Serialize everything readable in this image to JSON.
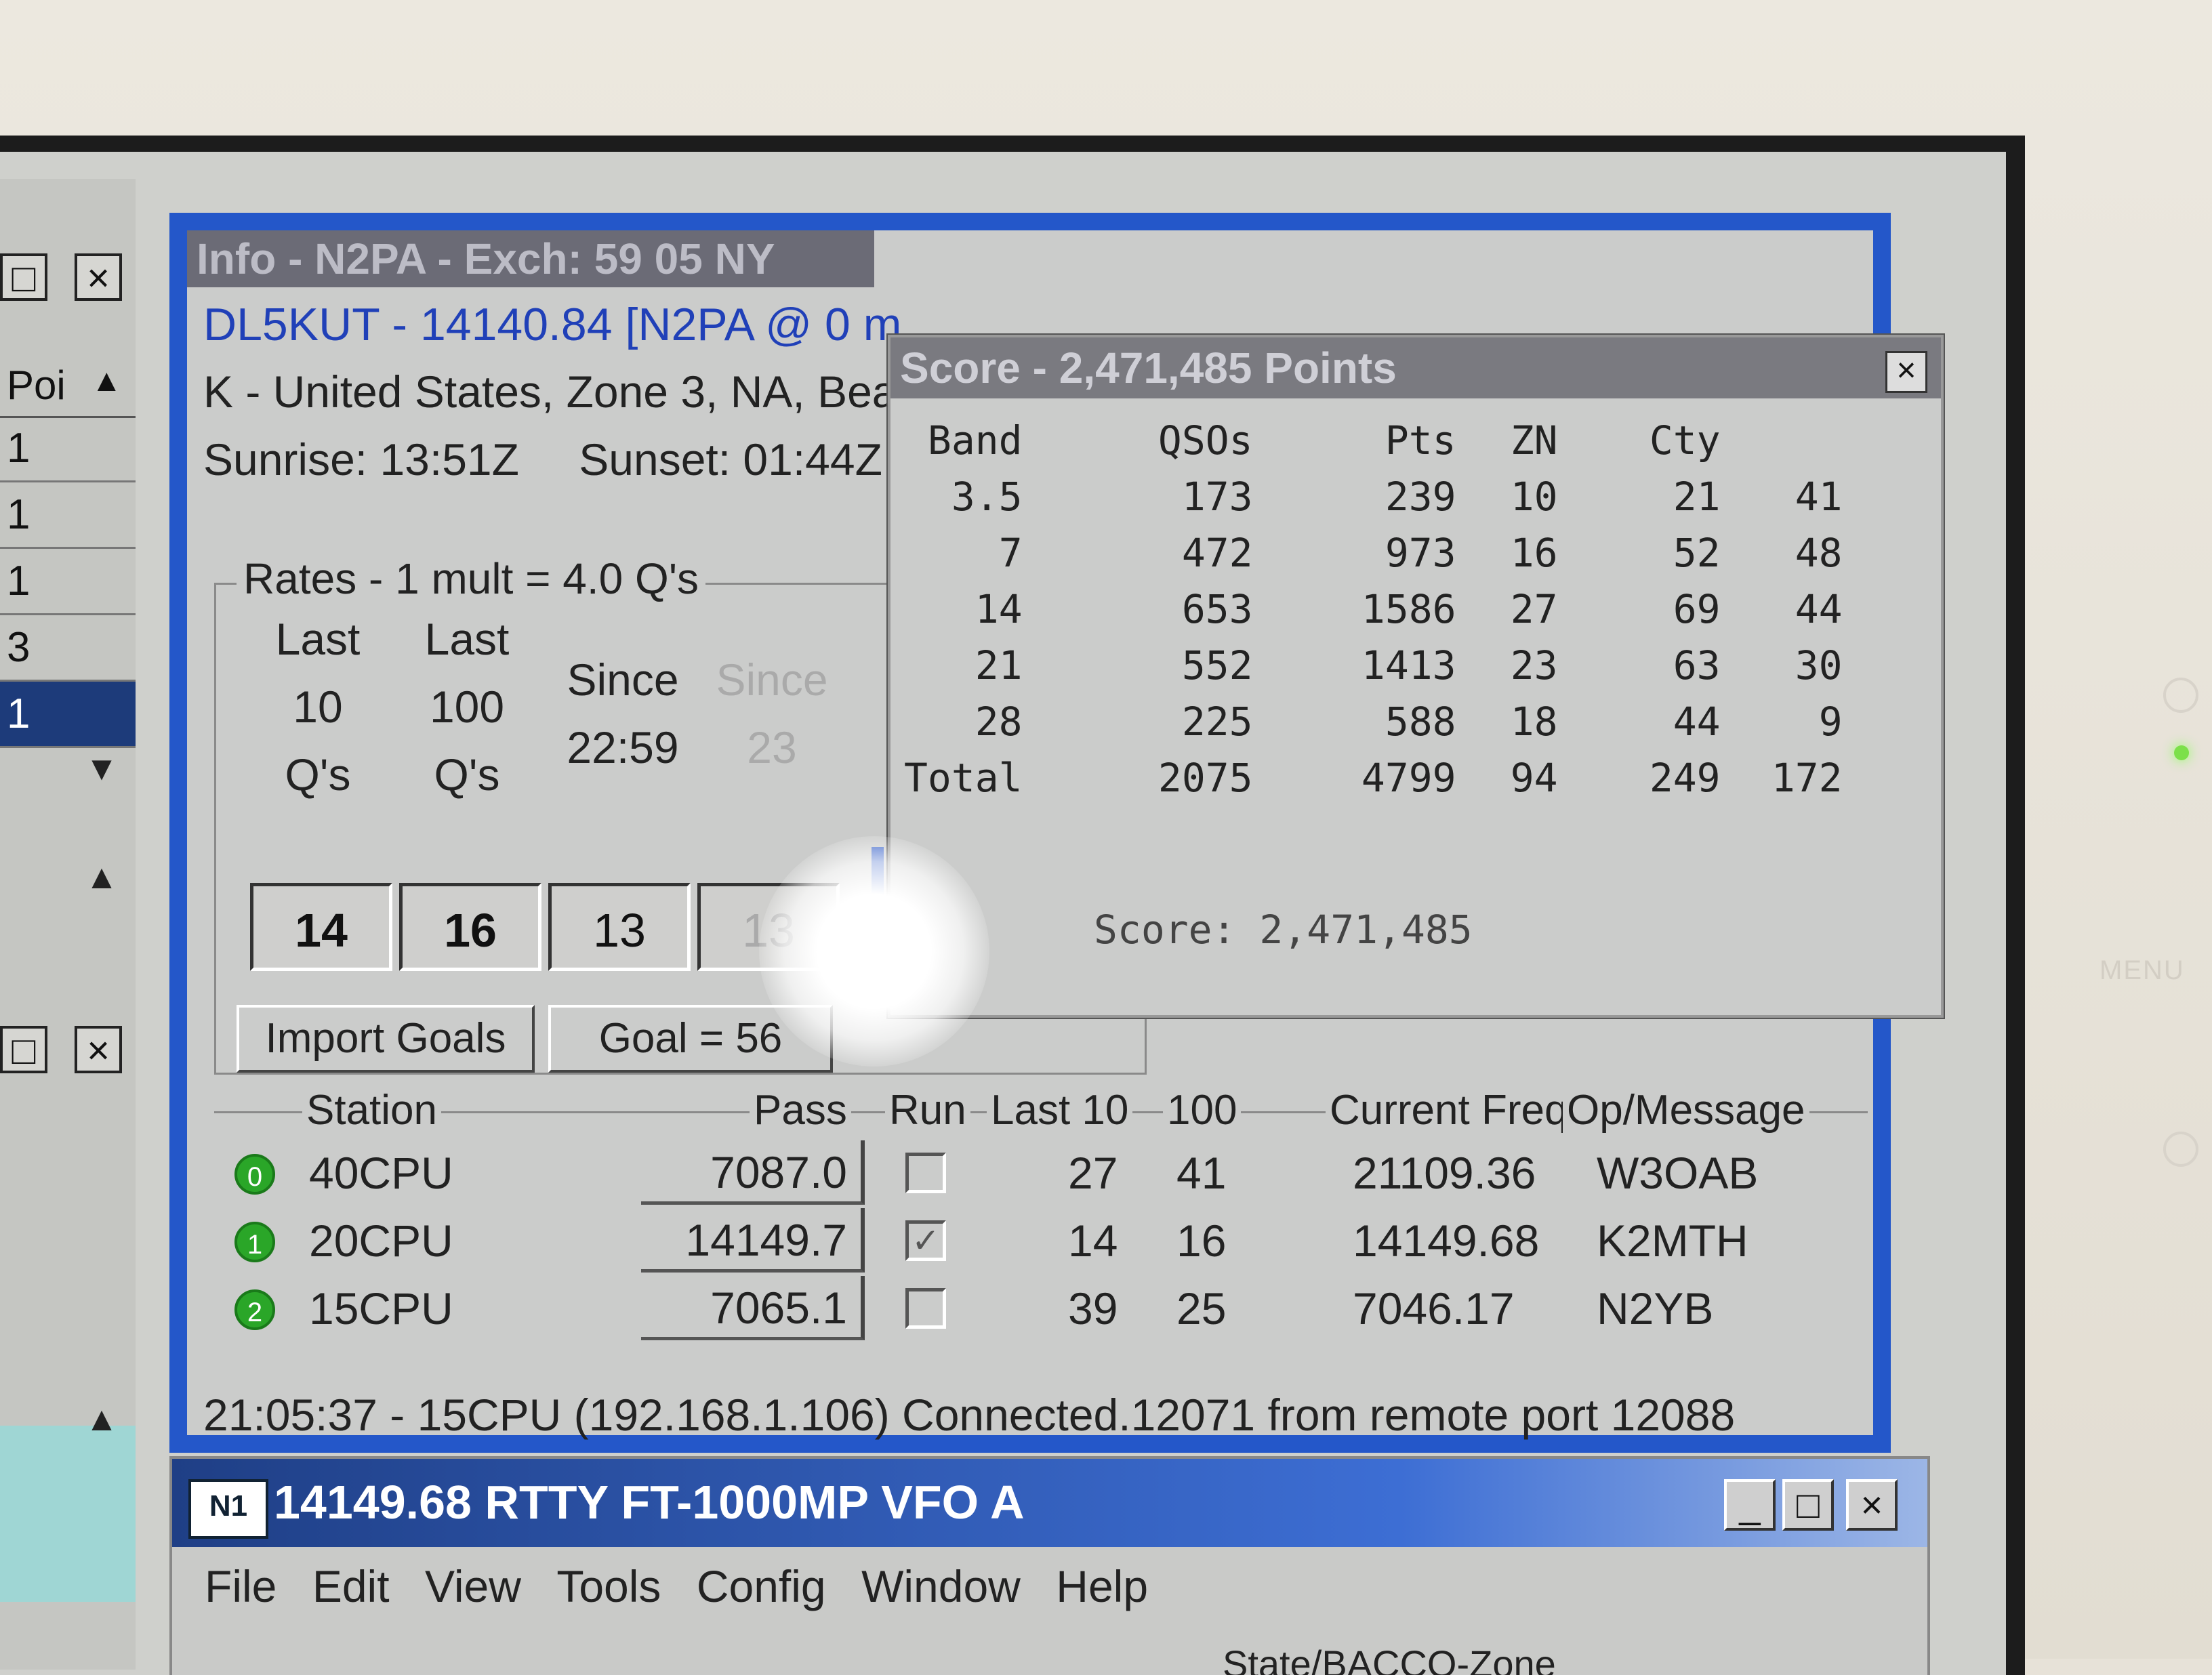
{
  "left_window": {
    "poi_header": "Poi",
    "rows": [
      "1",
      "1",
      "1",
      "3",
      "1"
    ]
  },
  "info": {
    "title": "Info - N2PA - Exch: 59 05 NY",
    "call_line": "DL5KUT - 14140.84 [N2PA @ 0 m",
    "country_line": "K - United States, Zone 3, NA, Bea",
    "sunrise": "Sunrise: 13:51Z",
    "sunset": "Sunset: 01:44Z",
    "rates": {
      "title": "Rates - 1 mult = 4.0 Q's",
      "col1": [
        "Last",
        "10",
        "Q's"
      ],
      "col2": [
        "Last",
        "100",
        "Q's"
      ],
      "col3": [
        "Since",
        "22:59"
      ],
      "col4": [
        "Since",
        "23"
      ],
      "values": [
        "14",
        "16",
        "13",
        "13"
      ],
      "import_goals": "Import Goals",
      "goal": "Goal = 56"
    },
    "stations": {
      "headers": {
        "station": "Station",
        "pass": "Pass",
        "run": "Run",
        "last10": "Last 10",
        "h100": "100",
        "freq": "Current Freq",
        "op": "Op/Message"
      },
      "rows": [
        {
          "num": "0",
          "name": "40CPU",
          "pass": "7087.0",
          "run": "",
          "last10": "27",
          "h100": "41",
          "freq": "21109.36",
          "op": "W3OAB"
        },
        {
          "num": "1",
          "name": "20CPU",
          "pass": "14149.7",
          "run": "✓",
          "last10": "14",
          "h100": "16",
          "freq": "14149.68",
          "op": "K2MTH"
        },
        {
          "num": "2",
          "name": "15CPU",
          "pass": "7065.1",
          "run": "",
          "last10": "39",
          "h100": "25",
          "freq": "7046.17",
          "op": "N2YB"
        }
      ]
    },
    "status": "21:05:37 - 15CPU (192.168.1.106) Connected.12071 from remote port 12088"
  },
  "score": {
    "title": "Score - 2,471,485 Points",
    "headers": [
      "Band",
      "QSOs",
      "Pts",
      "ZN",
      "Cty",
      ""
    ],
    "rows": [
      [
        "3.5",
        "173",
        "239",
        "10",
        "21",
        "41"
      ],
      [
        "7",
        "472",
        "973",
        "16",
        "52",
        "48"
      ],
      [
        "14",
        "653",
        "1586",
        "27",
        "69",
        "44"
      ],
      [
        "21",
        "552",
        "1413",
        "23",
        "63",
        "30"
      ],
      [
        "28",
        "225",
        "588",
        "18",
        "44",
        "9"
      ],
      [
        "Total",
        "2075",
        "4799",
        "94",
        "249",
        "172"
      ]
    ],
    "score_line": "Score: 2,471,485"
  },
  "main_window": {
    "title": "14149.68 RTTY FT-1000MP VFO A",
    "logo": "N1",
    "menu": [
      "File",
      "Edit",
      "View",
      "Tools",
      "Config",
      "Window",
      "Help"
    ],
    "subheader": "State/BACCO-Zone"
  },
  "monitor": {
    "menu_label": "MENU"
  },
  "colors": {
    "title_active": "#2457c9",
    "call_text": "#2040b8",
    "station_dot": "#2aa628"
  }
}
